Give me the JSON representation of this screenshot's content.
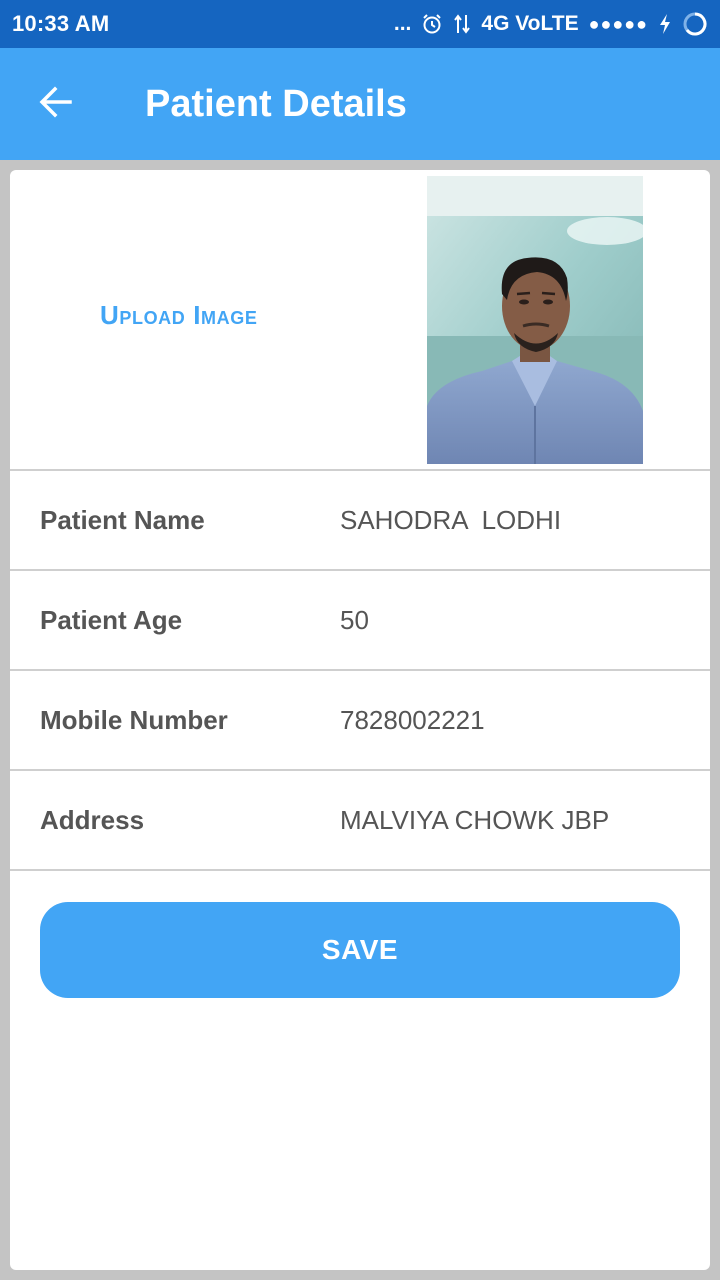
{
  "status_bar": {
    "time": "10:33 AM",
    "more": "...",
    "network": "4G VoLTE",
    "signal": "●●●●●"
  },
  "header": {
    "title": "Patient Details",
    "back_icon": "arrow-left-icon"
  },
  "image_section": {
    "upload_label": "Upload Image"
  },
  "fields": [
    {
      "label": "Patient Name",
      "value": "SAHODRA  LODHI"
    },
    {
      "label": "Patient Age",
      "value": "50"
    },
    {
      "label": "Mobile Number",
      "value": "7828002221"
    },
    {
      "label": "Address",
      "value": "MALVIYA CHOWK JBP"
    }
  ],
  "actions": {
    "save_label": "SAVE"
  },
  "colors": {
    "status_bar": "#1565c0",
    "accent": "#42a5f5",
    "text": "#555555"
  }
}
